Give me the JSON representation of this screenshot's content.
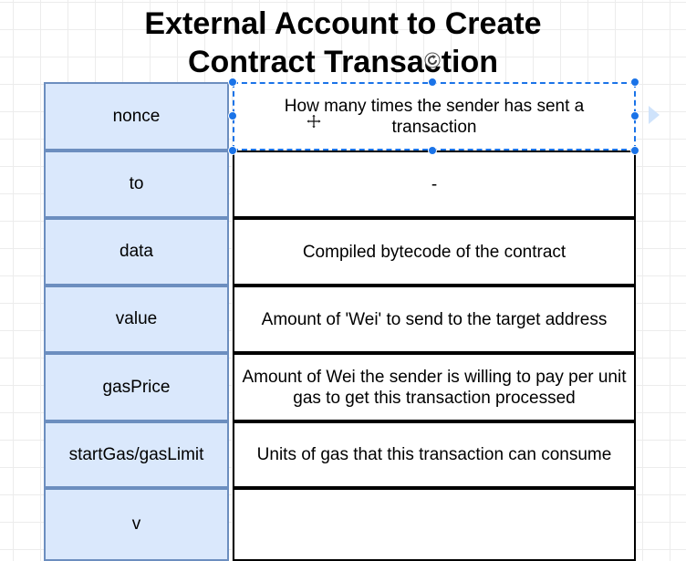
{
  "title": {
    "line1": "External Account to Create",
    "line2": "Contract Transaction"
  },
  "rows": [
    {
      "key": "nonce",
      "value": "How many times the sender has sent a transaction"
    },
    {
      "key": "to",
      "value": "-"
    },
    {
      "key": "data",
      "value": "Compiled bytecode of the contract"
    },
    {
      "key": "value",
      "value": "Amount of 'Wei' to send to the target address"
    },
    {
      "key": "gasPrice",
      "value": "Amount of Wei the sender is willing to pay per unit gas to get this transaction processed"
    },
    {
      "key": "startGas/gasLimit",
      "value": "Units of gas that this transaction can consume"
    },
    {
      "key": "v",
      "value": ""
    }
  ],
  "selection": {
    "selected_row_index": 0,
    "icons": [
      "rotate-icon",
      "move-icon",
      "connection-arrow-icon"
    ]
  },
  "colors": {
    "key_fill": "#dae8fc",
    "key_border": "#6c8ebf",
    "value_border": "#000000",
    "selection": "#1a73e8"
  }
}
